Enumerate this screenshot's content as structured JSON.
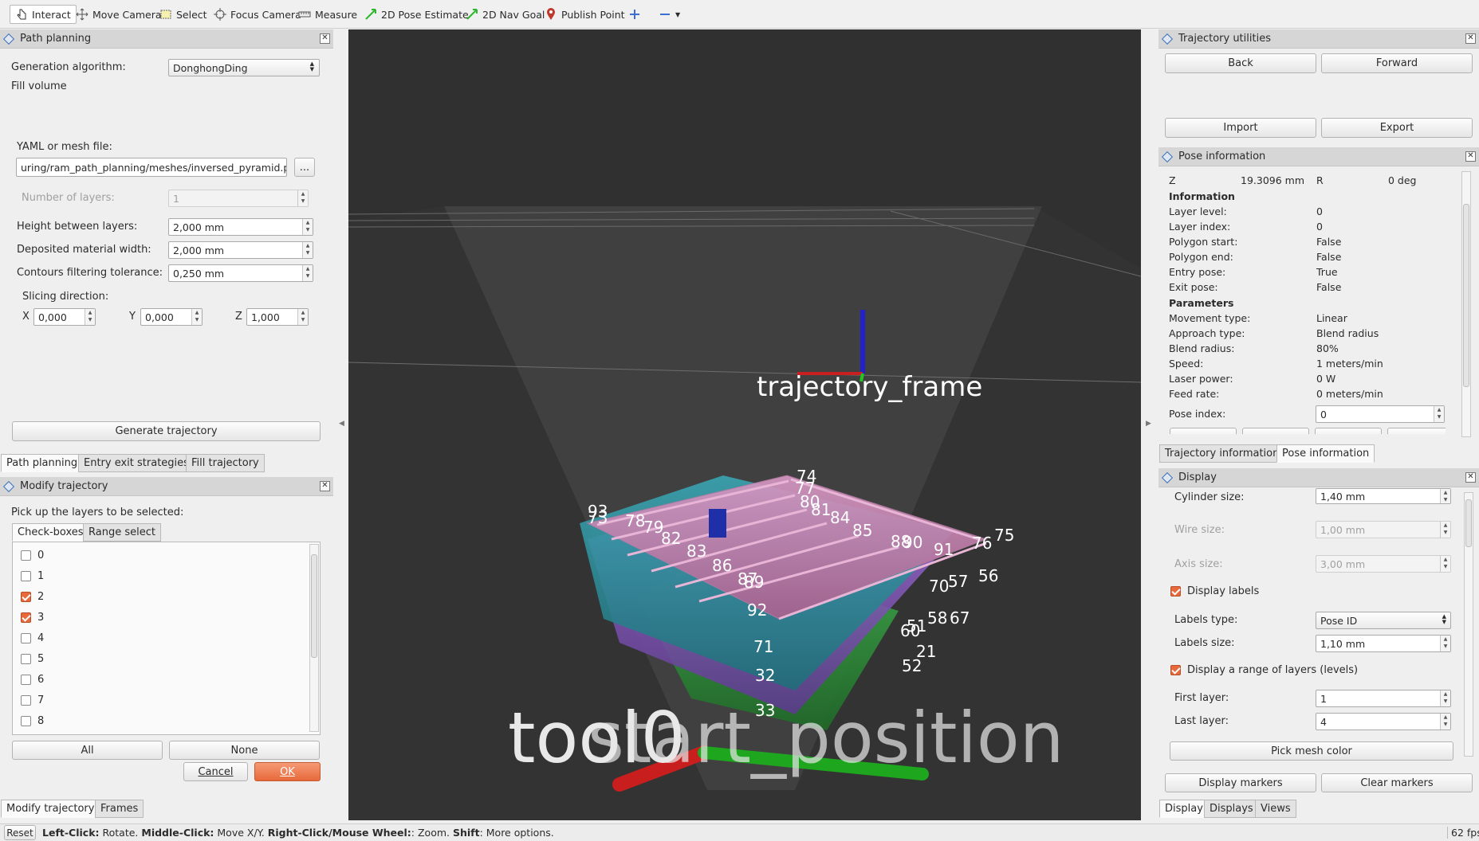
{
  "toolbar": {
    "interact": "Interact",
    "move_camera": "Move Camera",
    "select": "Select",
    "focus_camera": "Focus Camera",
    "measure": "Measure",
    "pose_estimate": "2D Pose Estimate",
    "nav_goal": "2D Nav Goal",
    "publish_point": "Publish Point"
  },
  "path_planning": {
    "title": "Path planning",
    "generation_algorithm_label": "Generation algorithm:",
    "generation_algorithm_value": "DonghongDing",
    "fill_volume": "Fill volume",
    "yaml_label": "YAML or mesh file:",
    "yaml_value": "uring/ram_path_planning/meshes/inversed_pyramid.ply",
    "browse": "...",
    "layers_label": "Number of layers:",
    "layers_value": "1",
    "height_label": "Height between layers:",
    "height_value": "2,000 mm",
    "width_label": "Deposited material width:",
    "width_value": "2,000 mm",
    "tolerance_label": "Contours filtering tolerance:",
    "tolerance_value": "0,250 mm",
    "slicing_label": "Slicing direction:",
    "x_label": "X",
    "x_value": "0,000",
    "y_label": "Y",
    "y_value": "0,000",
    "z_label": "Z",
    "z_value": "1,000",
    "generate": "Generate trajectory"
  },
  "left_tabs_top": [
    "Path planning",
    "Entry exit strategies",
    "Fill trajectory"
  ],
  "modify": {
    "title": "Modify trajectory",
    "instruction": "Pick up the layers to be selected:",
    "tabs": [
      "Check-boxes",
      "Range select"
    ],
    "layers": [
      {
        "label": "0",
        "checked": false
      },
      {
        "label": "1",
        "checked": false
      },
      {
        "label": "2",
        "checked": true
      },
      {
        "label": "3",
        "checked": true
      },
      {
        "label": "4",
        "checked": false
      },
      {
        "label": "5",
        "checked": false
      },
      {
        "label": "6",
        "checked": false
      },
      {
        "label": "7",
        "checked": false
      },
      {
        "label": "8",
        "checked": false
      }
    ],
    "all": "All",
    "none": "None",
    "cancel": "Cancel",
    "ok": "OK"
  },
  "left_tabs_bottom": [
    "Modify trajectory",
    "Frames"
  ],
  "viewport": {
    "frame_label": "trajectory_frame",
    "tool_label": "tool0",
    "ghost_label": "start_position",
    "pose_labels": [
      "74",
      "77",
      "80",
      "81",
      "84",
      "85",
      "88",
      "90",
      "91",
      "76",
      "75",
      "73",
      "93",
      "78",
      "79",
      "82",
      "83",
      "86",
      "87",
      "89",
      "92",
      "71",
      "70",
      "57",
      "56",
      "58",
      "67",
      "60",
      "51",
      "52",
      "21",
      "32",
      "33"
    ]
  },
  "trajectory_utilities": {
    "title": "Trajectory utilities",
    "back": "Back",
    "forward": "Forward",
    "import": "Import",
    "export": "Export"
  },
  "pose_information": {
    "title": "Pose information",
    "z_label": "Z",
    "z_value": "19.3096 mm",
    "r_label": "R",
    "r_value": "0 deg",
    "info_header": "Information",
    "info_rows": [
      {
        "k": "Layer level:",
        "v": "0"
      },
      {
        "k": "Layer index:",
        "v": "0"
      },
      {
        "k": "Polygon start:",
        "v": "False"
      },
      {
        "k": "Polygon end:",
        "v": "False"
      },
      {
        "k": "Entry pose:",
        "v": "True"
      },
      {
        "k": "Exit pose:",
        "v": "False"
      }
    ],
    "params_header": "Parameters",
    "param_rows": [
      {
        "k": "Movement type:",
        "v": "Linear"
      },
      {
        "k": "Approach type:",
        "v": "Blend radius"
      },
      {
        "k": "Blend radius:",
        "v": "80%"
      },
      {
        "k": "Speed:",
        "v": "1 meters/min"
      },
      {
        "k": "Laser power:",
        "v": "0 W"
      },
      {
        "k": "Feed rate:",
        "v": "0 meters/min"
      }
    ],
    "pose_index_label": "Pose index:",
    "pose_index_value": "0"
  },
  "right_tabs_top": [
    "Trajectory information",
    "Pose information"
  ],
  "display": {
    "title": "Display",
    "cylinder_label": "Cylinder size:",
    "cylinder_value": "1,40 mm",
    "wire_label": "Wire size:",
    "wire_value": "1,00 mm",
    "axis_label": "Axis size:",
    "axis_value": "3,00 mm",
    "display_labels": "Display labels",
    "labels_type_label": "Labels type:",
    "labels_type_value": "Pose ID",
    "labels_size_label": "Labels size:",
    "labels_size_value": "1,10 mm",
    "display_range": "Display a range of layers (levels)",
    "first_layer_label": "First layer:",
    "first_layer_value": "1",
    "last_layer_label": "Last layer:",
    "last_layer_value": "4",
    "pick_mesh": "Pick mesh color",
    "display_markers": "Display markers",
    "clear_markers": "Clear markers"
  },
  "right_tabs_bottom": [
    "Display",
    "Displays",
    "Views"
  ],
  "status": {
    "reset": "Reset",
    "left_click": "Left-Click:",
    "left_desc": " Rotate. ",
    "middle_click": "Middle-Click:",
    "middle_desc": " Move X/Y. ",
    "right_click": "Right-Click/Mouse Wheel:",
    "right_desc": ": Zoom. ",
    "shift": "Shift",
    "shift_desc": ": More options.",
    "fps": "62 fps"
  },
  "colors": {
    "accent_orange": "#e8693b",
    "viewport_bg": "#303030",
    "pink_layer": "#c07aa8",
    "teal_layer": "#2d8a96",
    "purple_layer": "#7c4fb3",
    "green_layer": "#2e8a3a"
  }
}
